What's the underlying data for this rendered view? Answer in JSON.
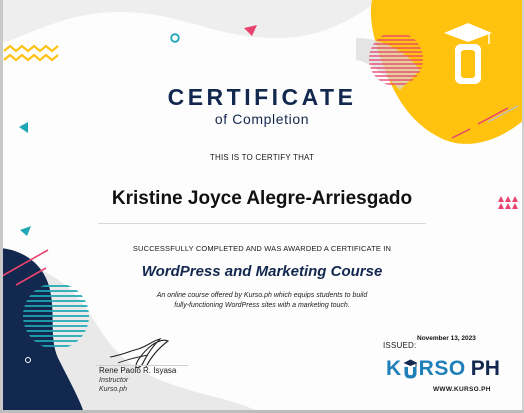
{
  "certificate": {
    "title": "CERTIFICATE",
    "subtitle": "of Completion",
    "certify_text": "THIS IS TO CERTIFY THAT",
    "recipient_name": "Kristine Joyce Alegre-Arriesgado",
    "completed_text": "SUCCESSFULLY COMPLETED AND WAS AWARDED A CERTIFICATE IN",
    "course_name": "WordPress and Marketing Course",
    "description": [
      "An online course offered by Kurso.ph which equips students to build",
      "fully-functioning WordPress sites with a marketing touch."
    ]
  },
  "signatory": {
    "name": "Rene Paolo R. Isyasa",
    "role": "Instructor",
    "organization": "Kurso.ph"
  },
  "issue": {
    "label": "ISSUED:",
    "date": "November 13, 2023"
  },
  "brand": {
    "logo_prefix": "K",
    "logo_middle": "RSO",
    "logo_suffix": "PH",
    "website": "WWW.KURSO.PH"
  },
  "colors": {
    "navy": "#13284f",
    "brand_blue": "#1f7fb8",
    "yellow": "#ffc20e",
    "pink": "#e8436f",
    "teal": "#20a7b5"
  },
  "icons": [
    "graduation-cap-bottle-icon",
    "signature-mark",
    "kurso-u-graduation-icon"
  ]
}
